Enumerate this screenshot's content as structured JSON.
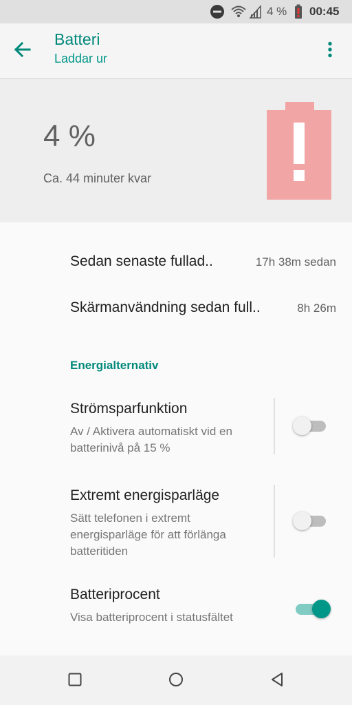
{
  "status_bar": {
    "battery_percent": "4 %",
    "time": "00:45",
    "icons": [
      "do-not-disturb-icon",
      "wifi-icon",
      "cell-signal-icon",
      "battery-alert-icon"
    ]
  },
  "app_bar": {
    "title": "Batteri",
    "subtitle": "Laddar ur",
    "icons": [
      "back-arrow-icon",
      "more-vert-icon"
    ]
  },
  "battery": {
    "percent": "4 %",
    "level": 0.04,
    "remaining": "Ca. 44 minuter kvar",
    "icon": "battery-alert-icon"
  },
  "stats": [
    {
      "label": "Sedan senaste fullad..",
      "value": "17h 38m sedan"
    },
    {
      "label": "Skärmanvändning sedan full..",
      "value": "8h 26m"
    }
  ],
  "section": {
    "title": "Energialternativ"
  },
  "settings": [
    {
      "title": "Strömsparfunktion",
      "summary": "Av / Aktivera automatiskt vid en batterinivå på 15 %",
      "enabled": false
    },
    {
      "title": "Extremt energisparläge",
      "summary": "Sätt telefonen i extremt energisparläge för att förlänga batteritiden",
      "enabled": false
    },
    {
      "title": "Batteriprocent",
      "summary": "Visa batteriprocent i statusfältet",
      "enabled": true
    }
  ],
  "nav": {
    "icons": [
      "recents-square-icon",
      "home-circle-icon",
      "back-triangle-icon"
    ]
  },
  "colors": {
    "accent": "#009688",
    "alert_battery": "#f2a5a5"
  }
}
